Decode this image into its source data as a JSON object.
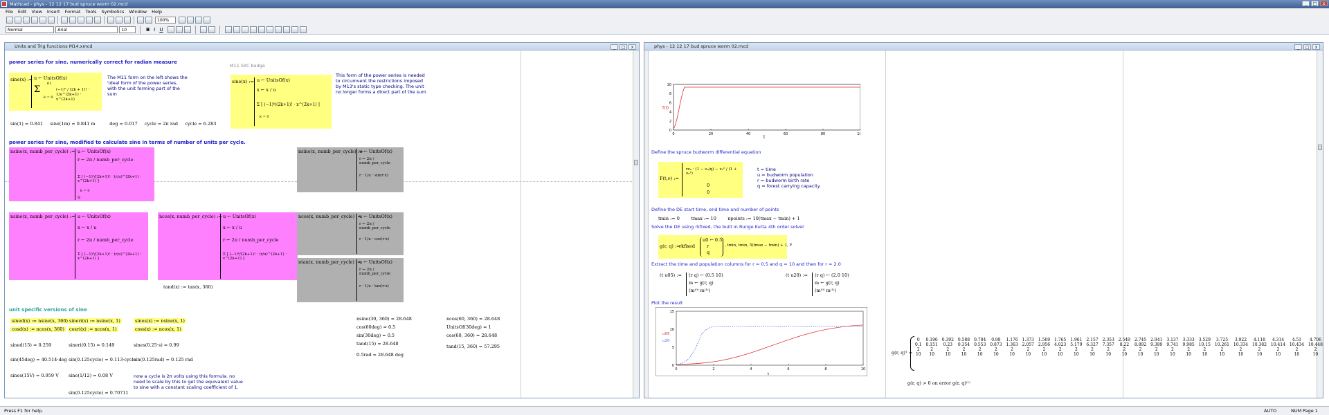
{
  "app": {
    "title": "Mathcad - phys - 12 12 17 bud spruce worm 02.mcd",
    "menu": [
      "File",
      "Edit",
      "View",
      "Insert",
      "Format",
      "Tools",
      "Symbolics",
      "Window",
      "Help"
    ],
    "zoom": "100%",
    "style_select": "Normal",
    "font_select": "Arial",
    "size_select": "10",
    "bold": "B",
    "italic": "I",
    "underline": "U",
    "status_left": "Press F1 for help.",
    "status_auto": "AUTO",
    "status_num": "NUM",
    "status_page": "Page 1"
  },
  "left_doc": {
    "title": "Units and Trig functions M14.xmcd",
    "heading1": "power series for sine.  numerically correct for radian measure",
    "m11_label": "M11 SIIC badge",
    "sine_def": "sine(x) :=",
    "sine_u": "u ← UnitsOf(x)",
    "sine_sum_top": "61",
    "sine_sum_bot": "k = 0",
    "sine_term": "(−1)ᵏ / (2k + 1)! · 1/u^(2k+1) · x^(2k+1)",
    "note1": "The M11 form on the left shows the 'ideal form of the power series, with the unit forming part of the sum",
    "sine2_def": "sine(x) :=",
    "sine2_u": "u ← UnitsOf(x)",
    "sine2_x": "x ← x / u",
    "sine2_sum": "Σ [ (−1)ᵏ/(2k+1)! · x^(2k+1) ]",
    "sine2_sum_bot": "k = 0",
    "note2": "This form of the power series is needed to circumvent the restrictions imposed by M13's static type checking.  The unit no longer forms a direct part of the sum",
    "res_line": "sin(1) = 0.841     sine(1m) = 0.841 m          deg = 0.017     cycle = 2π rad     cycle = 6.283",
    "heading2": "power series for sine, modified to calculate sine in terms of number of units per cycle.",
    "nsine_def": "nsine(x, numb_per_cycle) :=",
    "nsine_u": "u ← UnitsOf(x)",
    "nsine_r": "r ← 2π / numb_per_cycle",
    "nsine_sum": "Σ [ (−1)ᵏ/(2k+1)! · (r/u)^(2k+1) · x^(2k+1) ]",
    "nsine_sum_bot": "k = 0",
    "nsine_u_end": "u",
    "gsine_def": "nsine(x, numb_per_cycle) :=",
    "gsine_u": "u ← UnitsOf(x)",
    "gsine_r": "r ← 2π / numb_per_cycle",
    "gsine_x": "r · 1/u · sin(r·x)",
    "nsine2_def": "nsine(x, numb_per_cycle) :=",
    "nsine2_u": "u ← UnitsOf(x)",
    "nsine2_x": "x ← x / u",
    "nsine2_r": "r ← 2π / numb_per_cycle",
    "ncos_def": "ncos(x, numb_per_cycle) :=",
    "ncos_u": "u ← UnitsOf(x)",
    "ncos_x": "x ← x / u",
    "ncos_r": "r ← 2π / numb_per_cycle",
    "gcos_def": "ncos(x, numb_per_cycle) :=",
    "gcos_u": "u ← UnitsOf(x)",
    "gcos_r": "r ← 2π / numb_per_cycle",
    "gcos_x": "r · 1/u · cos(r·x)",
    "gtan_def": "ntan(x, numb_per_cycle) :=",
    "gtan_u": "u ← UnitsOf(x)",
    "gtan_r": "r ← 2π / numb_per_cycle",
    "gtan_x": "r · 1/u · tan(r·x)",
    "tand": "tand(x) := tan(x, 360)",
    "heading3": "unit specific versions of sine",
    "defs": [
      "sined(x) := nsine(x, 360)",
      "sineri(x) := nsine(x, 1)",
      "sines(x) := nsine(x, 1)",
      "cosd(x) := ncos(x, 360)",
      "cosri(x) := ncos(x, 1)",
      "coss(x) := ncos(x, 1)"
    ],
    "results_a": [
      "sined(15) = 0.259",
      "sineri(0.15) = 0.149",
      "sines(0.25·s) = 0.99"
    ],
    "results_b": [
      "sin(45deg) = 40.514·deg",
      "sin(0.125cycle) = 0.113·cycle",
      "sin(0.125rad) = 0.125 rad"
    ],
    "results_c": [
      "sines(15V) = 0.959 V",
      "sine(1/12) = 0.08 V",
      "sin(0.125cycle) = 0.70711"
    ],
    "note3": "now a cycle is 2π volts using this formula. no need to scale by this to get the equivalent value to sine with a constant scaling coefficient of 1.",
    "results_d": [
      "nsine(30, 360) = 28.648",
      "cos(60deg) = 0.5",
      "sin(30deg) = 0.5",
      "tand(15) = 28.648",
      "0.5rad = 28.648 deg"
    ],
    "results_e": [
      "ncos(60, 360) = 28.648",
      "UnitsOf(30deg) = 1",
      "cos(60, 360) = 28.648",
      "tand(15, 360) = 57.295"
    ]
  },
  "right_doc": {
    "title": "phys - 12 12 17 bud spruce worm 02.mcd",
    "plot1": {
      "yticks": [
        "10",
        "8",
        "6",
        "4",
        "2",
        "0"
      ],
      "xticks": [
        "0",
        "20",
        "40",
        "60",
        "80",
        "100"
      ],
      "ylabel": "f(t)",
      "xlabel": "t"
    },
    "heading_de": "Define the spruce budworm differential equation",
    "de_lhs": "F(t,ν) :=",
    "de_rhs1": "rν₀ · (1 − ν₀/q) − ν₀² / (1 + ν₀²)",
    "de_rhs2": "0",
    "de_rhs3": "0",
    "legend": [
      "t = time",
      "u = budworm population",
      "r = budworm birth rate",
      "q = forest carrying capacity"
    ],
    "heading_time": "Define the DE start time, end time and number of points",
    "time_defs": "tmin := 0        tmax := 10        npoints := 10(tmax − tmin) + 1",
    "heading_solve": "Solve the DE using rkfixed, the built in Runge Kutta 4th order solver",
    "solve_lhs": "g(r, q) :=",
    "solve_fn": "rkfixed",
    "solve_vec": [
      "u0 ← 0.5",
      "r",
      "q"
    ],
    "solve_args": ", tmin, tmin, 5(tmax − tmin) + 1, F",
    "heading_extract": "Extract the time and population columns for r = 0.5 and q = 10 and then for r = 2.0",
    "ex1_lhs": "(t  u05) :=",
    "ex1_rows": [
      "(r  q) ← (0.5  10)",
      "m ← g(r, q)",
      "(m⁽⁰⁾  m⁽¹⁾)"
    ],
    "ex2_lhs": "(t  u20) :=",
    "ex2_rows": [
      "(r  q) ← (2.0  10)",
      "m ← g(r, q)",
      "(m⁽⁰⁾  m⁽¹⁾)"
    ],
    "heading_plot": "Plot the result",
    "plot2": {
      "yticks": [
        "15",
        "10",
        "5",
        "0"
      ],
      "xticks": [
        "0",
        "2",
        "4",
        "6",
        "8",
        "10"
      ],
      "ylabel1": "u05",
      "ylabel2": "u20",
      "xlabel": "t"
    },
    "matrix_label": "g(r, q)ᵀ =",
    "matrix_rows": [
      [
        "0",
        "0.196",
        "0.392",
        "0.588",
        "0.784",
        "0.98",
        "1.176",
        "1.373",
        "1.569",
        "1.765",
        "1.961",
        "2.157",
        "2.353",
        "2.549",
        "2.745",
        "2.941",
        "3.137",
        "3.333",
        "3.529",
        "3.725",
        "3.922",
        "4.118",
        "4.314",
        "4.51",
        "4.706"
      ],
      [
        "0.1",
        "0.151",
        "0.23",
        "0.354",
        "0.553",
        "0.873",
        "1.363",
        "2.057",
        "2.956",
        "4.023",
        "5.179",
        "6.327",
        "7.357",
        "8.22",
        "8.892",
        "9.389",
        "9.741",
        "9.985",
        "10.15",
        "10.261",
        "10.334",
        "10.382",
        "10.414",
        "10.434",
        "10.448"
      ],
      [
        "2",
        "2",
        "2",
        "2",
        "2",
        "2",
        "2",
        "2",
        "2",
        "2",
        "2",
        "2",
        "2",
        "2",
        "2",
        "2",
        "2",
        "2",
        "2",
        "2",
        "2",
        "2",
        "2",
        "2",
        "2"
      ],
      [
        "10",
        "10",
        "10",
        "10",
        "10",
        "10",
        "10",
        "10",
        "10",
        "10",
        "10",
        "10",
        "10",
        "10",
        "10",
        "10",
        "10",
        "10",
        "10",
        "10",
        "10",
        "10",
        "10",
        "10",
        "10"
      ]
    ],
    "bottom_expr": "g(r, q) > 0   on error g(r, q)⁽¹⁾"
  },
  "colors": {
    "yellow": "#ffff80",
    "pink": "#ff80ff",
    "gray": "#b0b0b0",
    "heading": "#2222cc",
    "curve_red": "#e03030",
    "curve_blue": "#4a6bd8"
  }
}
